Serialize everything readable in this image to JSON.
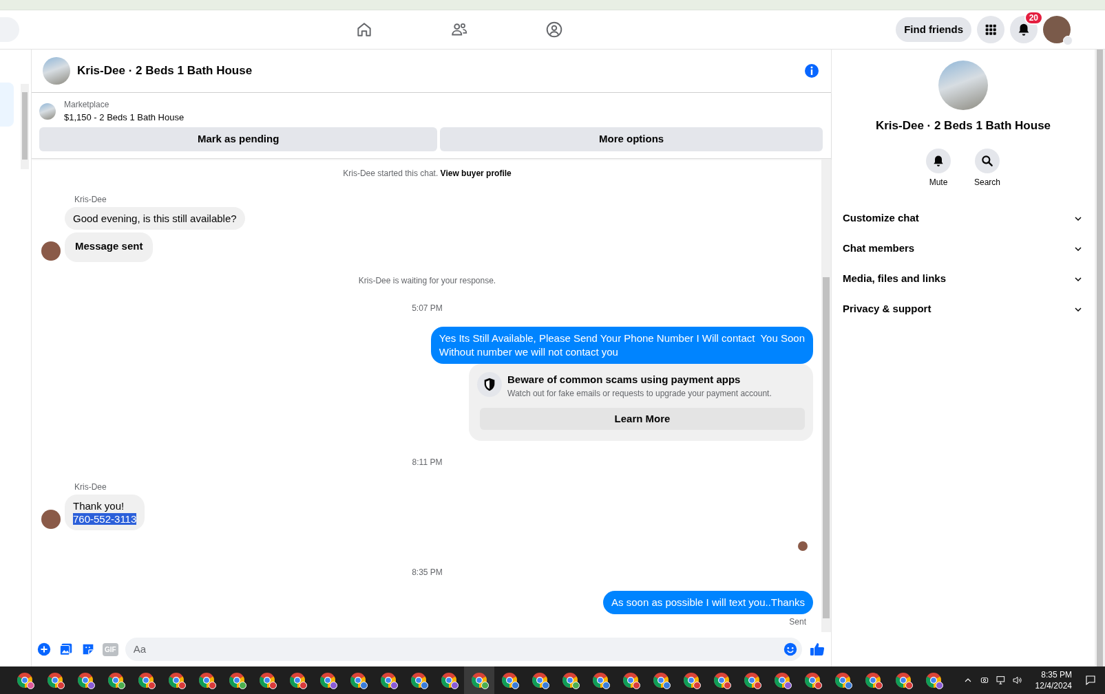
{
  "topbar": {
    "find_friends": "Find friends",
    "notification_count": "20"
  },
  "conversation": {
    "title": "Kris-Dee · 2 Beds 1 Bath House",
    "listing": {
      "source": "Marketplace",
      "summary": "$1,150 - 2 Beds 1 Bath House"
    },
    "actions": [
      "Mark as pending",
      "More options"
    ]
  },
  "messages": [
    {
      "kind": "system",
      "text": "Kris-Dee started this chat. ",
      "link": "View buyer profile"
    },
    {
      "kind": "incoming",
      "sender": "Kris-Dee",
      "bubbles": [
        {
          "bold": false,
          "lines": [
            {
              "text": "Good evening, is this still available?",
              "selected": false
            }
          ]
        },
        {
          "bold": true,
          "lines": [
            {
              "text": "Message sent",
              "selected": false
            }
          ]
        }
      ]
    },
    {
      "kind": "system",
      "text": "Kris-Dee is waiting for your response."
    },
    {
      "kind": "timestamp",
      "text": "5:07 PM"
    },
    {
      "kind": "outgoing",
      "lines": [
        "Yes Its Still Available, Please Send Your Phone Number I Will contact  You Soon",
        "Without number we will not contact you"
      ]
    },
    {
      "kind": "notice",
      "title": "Beware of common scams using payment apps",
      "body": "Watch out for fake emails or requests to upgrade your payment account.",
      "button": "Learn More"
    },
    {
      "kind": "timestamp",
      "text": "8:11 PM"
    },
    {
      "kind": "incoming",
      "sender": "Kris-Dee",
      "bubbles": [
        {
          "bold": false,
          "lines": [
            {
              "text": "Thank you!",
              "selected": false
            },
            {
              "text": "760-552-3113",
              "selected": true
            }
          ]
        }
      ]
    },
    {
      "kind": "seen"
    },
    {
      "kind": "timestamp",
      "text": "8:35 PM"
    },
    {
      "kind": "outgoing",
      "lines": [
        "As soon as possible I will text you..Thanks"
      ],
      "status": "Sent"
    }
  ],
  "composer": {
    "gif_label": "GIF",
    "placeholder": "Aa"
  },
  "details": {
    "title": "Kris-Dee · 2 Beds 1 Bath House",
    "actions": [
      {
        "kind": "mute",
        "label": "Mute"
      },
      {
        "kind": "search",
        "label": "Search"
      }
    ],
    "sections": [
      {
        "label": "Customize chat",
        "expanded": false
      },
      {
        "label": "Chat members",
        "expanded": false
      },
      {
        "label": "Media, files and links",
        "expanded": false
      },
      {
        "label": "Privacy & support",
        "expanded": false
      }
    ]
  },
  "taskbar": {
    "apps": [
      {
        "color": "#e05a9a",
        "selected": false
      },
      {
        "color": "#d93b3b",
        "selected": false
      },
      {
        "color": "#8a5cd6",
        "selected": false
      },
      {
        "color": "#4caf50",
        "selected": false
      },
      {
        "color": "#d93b3b",
        "selected": false
      },
      {
        "color": "#d93b3b",
        "selected": false
      },
      {
        "color": "#d93b3b",
        "selected": false
      },
      {
        "color": "#4caf50",
        "selected": false
      },
      {
        "color": "#d93b3b",
        "selected": false
      },
      {
        "color": "#d93b3b",
        "selected": false
      },
      {
        "color": "#8a5cd6",
        "selected": false
      },
      {
        "color": "#3b7dd9",
        "selected": false
      },
      {
        "color": "#8a5cd6",
        "selected": false
      },
      {
        "color": "#3b7dd9",
        "selected": false
      },
      {
        "color": "#8a5cd6",
        "selected": false
      },
      {
        "color": "#4caf50",
        "selected": true
      },
      {
        "color": "#3b7dd9",
        "selected": false
      },
      {
        "color": "#3b7dd9",
        "selected": false
      },
      {
        "color": "#4caf50",
        "selected": false
      },
      {
        "color": "#3b7dd9",
        "selected": false
      },
      {
        "color": "#d93b3b",
        "selected": false
      },
      {
        "color": "#3b7dd9",
        "selected": false
      },
      {
        "color": "#d93b3b",
        "selected": false
      },
      {
        "color": "#d93b3b",
        "selected": false
      },
      {
        "color": "#d93b3b",
        "selected": false
      },
      {
        "color": "#8a5cd6",
        "selected": false
      },
      {
        "color": "#d93b3b",
        "selected": false
      },
      {
        "color": "#3b7dd9",
        "selected": false
      },
      {
        "color": "#d93b3b",
        "selected": false
      },
      {
        "color": "#d93b3b",
        "selected": false
      },
      {
        "color": "#8a5cd6",
        "selected": false
      }
    ],
    "clock": {
      "time": "8:35 PM",
      "date": "12/4/2024"
    }
  }
}
